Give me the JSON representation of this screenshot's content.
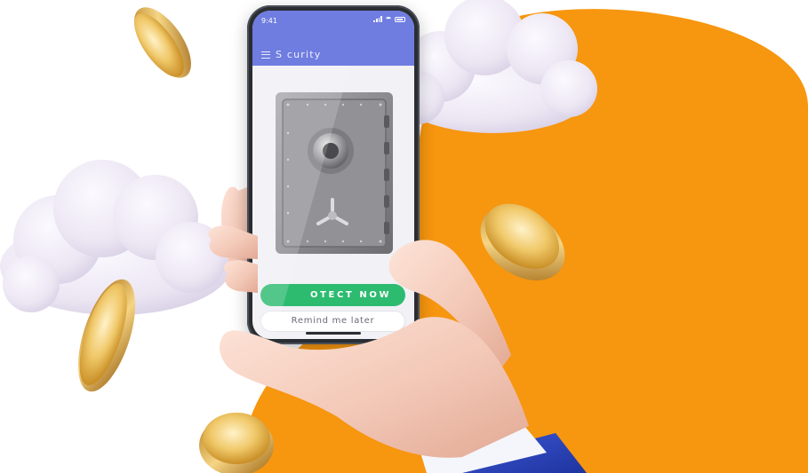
{
  "status_bar": {
    "time": "9:41"
  },
  "app": {
    "title": "S curity",
    "primary_button": "OTECT NOW",
    "secondary_button": "Remind me later"
  },
  "colors": {
    "background": "#ffffff",
    "orange_blob": "#f7960f",
    "header_blue": "#6f7de0",
    "button_green": "#2dbb70",
    "coin_gold": "#e8b84a",
    "cloud": "#ece8f2",
    "skin": "#f3cfc0",
    "sleeve_white": "#f4f6fb",
    "jacket_blue": "#2741b8",
    "safe_grey": "#8f8f93"
  },
  "icons": [
    "menu-icon",
    "signal-icon",
    "wifi-icon",
    "battery-icon",
    "safe-dial-icon",
    "safe-handle-icon"
  ]
}
